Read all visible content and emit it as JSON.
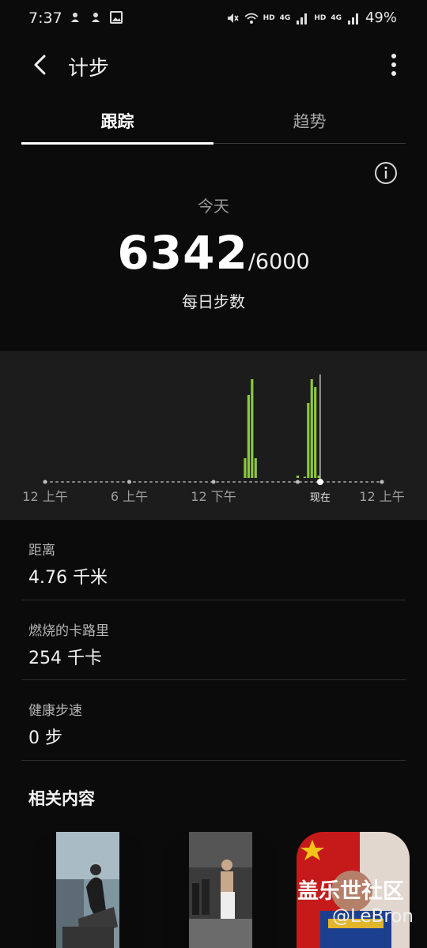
{
  "status_bar": {
    "time": "7:37",
    "battery": "49%",
    "hd_1": "HD",
    "net_1": "4G",
    "hd_2": "HD",
    "net_2": "4G"
  },
  "app_bar": {
    "title": "计步",
    "back_icon": "chevron-left-icon",
    "menu_icon": "more-vert-icon"
  },
  "tabs": [
    {
      "label": "跟踪",
      "active": true
    },
    {
      "label": "趋势",
      "active": false
    }
  ],
  "summary": {
    "info_icon": "info-icon",
    "today_label": "今天",
    "steps": "6342",
    "goal": "/6000",
    "daily_label": "每日步数"
  },
  "chart_data": {
    "type": "bar",
    "x_ticks": [
      "12 上午",
      "6 上午",
      "12 下午",
      "现在",
      "12 上午"
    ],
    "now_marker": "现在",
    "bar_color": "#8dc63f",
    "x_unit": "hour",
    "bars": [
      {
        "x": 14.25,
        "value": 25
      },
      {
        "x": 14.5,
        "value": 105
      },
      {
        "x": 14.75,
        "value": 125
      },
      {
        "x": 15.0,
        "value": 25
      },
      {
        "x": 18.0,
        "value": 3
      },
      {
        "x": 18.5,
        "value": 1
      },
      {
        "x": 18.75,
        "value": 95
      },
      {
        "x": 19.0,
        "value": 125
      },
      {
        "x": 19.25,
        "value": 115
      },
      {
        "x": 19.5,
        "value": 3
      }
    ],
    "x_range": [
      0,
      24
    ],
    "now_hour": 19.6,
    "y_max": 130
  },
  "stats": [
    {
      "label": "距离",
      "value": "4.76 千米"
    },
    {
      "label": "燃烧的卡路里",
      "value": "254 千卡"
    },
    {
      "label": "健康步速",
      "value": "0 步"
    }
  ],
  "related": {
    "title": "相关内容",
    "watermark": "盖乐世社区",
    "watermark_user": "@LeBron"
  }
}
